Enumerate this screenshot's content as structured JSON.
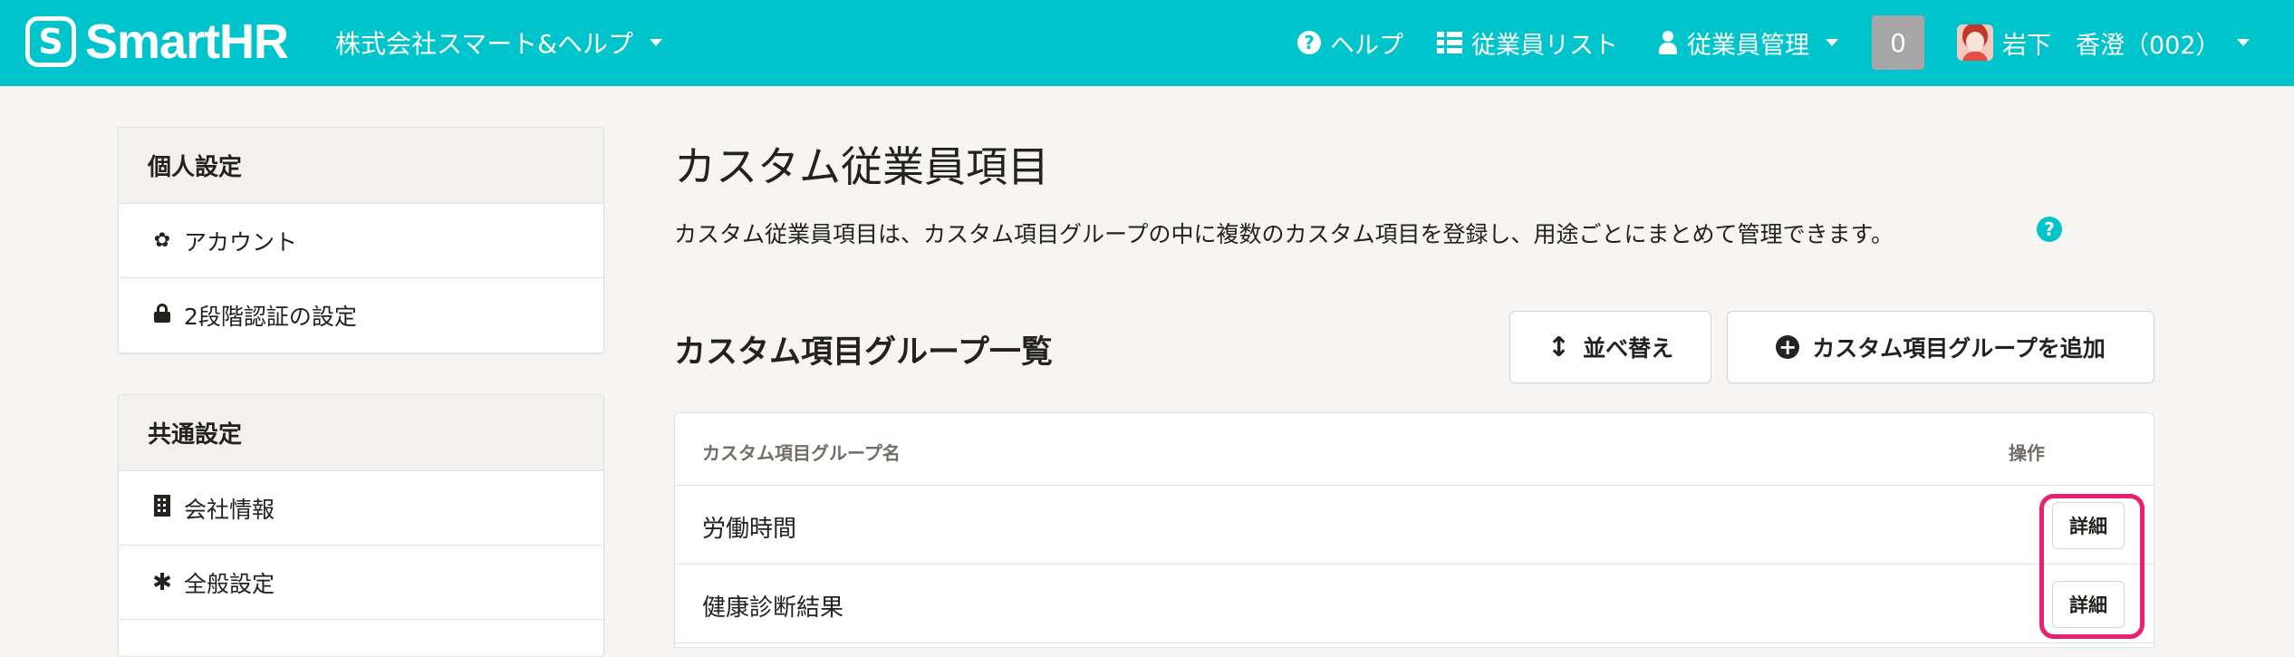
{
  "header": {
    "logo_mark": "S",
    "logo_text": "SmartHR",
    "company_name": "株式会社スマート&ヘルプ",
    "nav_help": "ヘルプ",
    "nav_employee_list": "従業員リスト",
    "nav_employee_mgmt": "従業員管理",
    "notification_count": "0",
    "user_name": "岩下　香澄（002）",
    "colors": {
      "bar": "#00c4cc"
    }
  },
  "sidebar": {
    "personal": {
      "heading": "個人設定",
      "items": [
        {
          "label": "アカウント",
          "icon": "gear-icon"
        },
        {
          "label": "2段階認証の設定",
          "icon": "lock-icon"
        }
      ]
    },
    "common": {
      "heading": "共通設定",
      "items": [
        {
          "label": "会社情報",
          "icon": "building-icon"
        },
        {
          "label": "全般設定",
          "icon": "asterisk-icon"
        }
      ]
    }
  },
  "main": {
    "title": "カスタム従業員項目",
    "description": "カスタム従業員項目は、カスタム項目グループの中に複数のカスタム項目を登録し、用途ごとにまとめて管理できます。",
    "section_title": "カスタム項目グループ一覧",
    "sort_button": "並べ替え",
    "add_button": "カスタム項目グループを追加",
    "table": {
      "headers": [
        "カスタム項目グループ名",
        "操作"
      ],
      "rows": [
        {
          "name": "労働時間",
          "action": "詳細"
        },
        {
          "name": "健康診断結果",
          "action": "詳細"
        }
      ]
    },
    "highlight_color": "#e8206e"
  }
}
